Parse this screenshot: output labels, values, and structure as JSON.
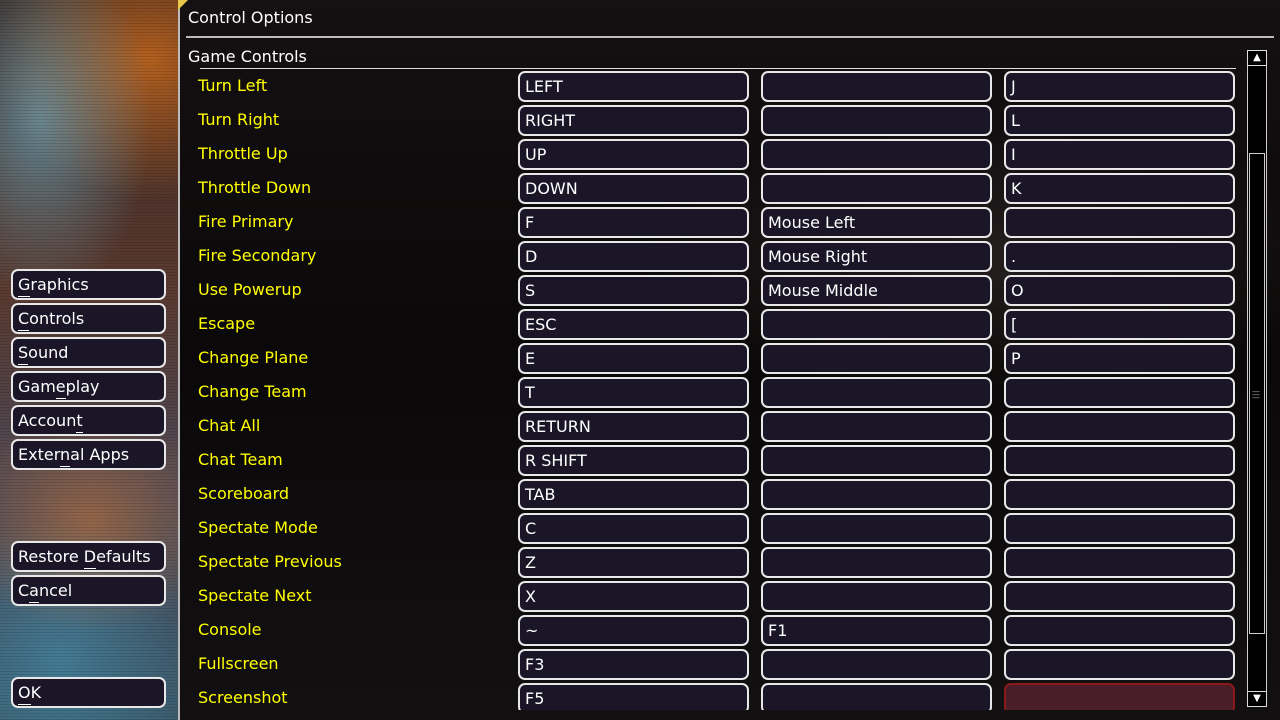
{
  "window": {
    "title": "Control Options",
    "section": "Game Controls"
  },
  "sidebar": {
    "nav": [
      {
        "label": "Graphics",
        "mnemonic": 0
      },
      {
        "label": "Controls",
        "mnemonic": 0
      },
      {
        "label": "Sound",
        "mnemonic": 0
      },
      {
        "label": "Gameplay",
        "mnemonic": 3
      },
      {
        "label": "Account",
        "mnemonic": 6
      },
      {
        "label": "External Apps",
        "mnemonic": 5
      }
    ],
    "actions": [
      {
        "label": "Restore Defaults",
        "mnemonic": 8
      },
      {
        "label": "Cancel",
        "mnemonic": 1
      }
    ],
    "ok": {
      "label": "OK",
      "mnemonic": 0
    }
  },
  "controls": [
    {
      "action": "Turn Left",
      "keys": [
        "LEFT",
        "",
        "J"
      ]
    },
    {
      "action": "Turn Right",
      "keys": [
        "RIGHT",
        "",
        "L"
      ]
    },
    {
      "action": "Throttle Up",
      "keys": [
        "UP",
        "",
        "I"
      ]
    },
    {
      "action": "Throttle Down",
      "keys": [
        "DOWN",
        "",
        "K"
      ]
    },
    {
      "action": "Fire Primary",
      "keys": [
        "F",
        "Mouse Left",
        ""
      ]
    },
    {
      "action": "Fire Secondary",
      "keys": [
        "D",
        "Mouse Right",
        "."
      ]
    },
    {
      "action": "Use Powerup",
      "keys": [
        "S",
        "Mouse Middle",
        "O"
      ]
    },
    {
      "action": "Escape",
      "keys": [
        "ESC",
        "",
        "["
      ]
    },
    {
      "action": "Change Plane",
      "keys": [
        "E",
        "",
        "P"
      ]
    },
    {
      "action": "Change Team",
      "keys": [
        "T",
        "",
        ""
      ]
    },
    {
      "action": "Chat All",
      "keys": [
        "RETURN",
        "",
        ""
      ]
    },
    {
      "action": "Chat Team",
      "keys": [
        "R SHIFT",
        "",
        ""
      ]
    },
    {
      "action": "Scoreboard",
      "keys": [
        "TAB",
        "",
        ""
      ]
    },
    {
      "action": "Spectate Mode",
      "keys": [
        "C",
        "",
        ""
      ]
    },
    {
      "action": "Spectate Previous",
      "keys": [
        "Z",
        "",
        ""
      ]
    },
    {
      "action": "Spectate Next",
      "keys": [
        "X",
        "",
        ""
      ]
    },
    {
      "action": "Console",
      "keys": [
        "~",
        "F1",
        ""
      ]
    },
    {
      "action": "Fullscreen",
      "keys": [
        "F3",
        "",
        ""
      ]
    },
    {
      "action": "Screenshot",
      "keys": [
        "F5",
        "",
        ""
      ]
    }
  ],
  "selected_binding": {
    "row": 18,
    "column": 2
  },
  "colors": {
    "label": "#ffff00",
    "field": "#1a1628",
    "selected_field": "#4a1e28",
    "accent": "#e8c84a"
  },
  "icons": {
    "scroll_up": "triangle-up-icon",
    "scroll_down": "triangle-down-icon"
  }
}
